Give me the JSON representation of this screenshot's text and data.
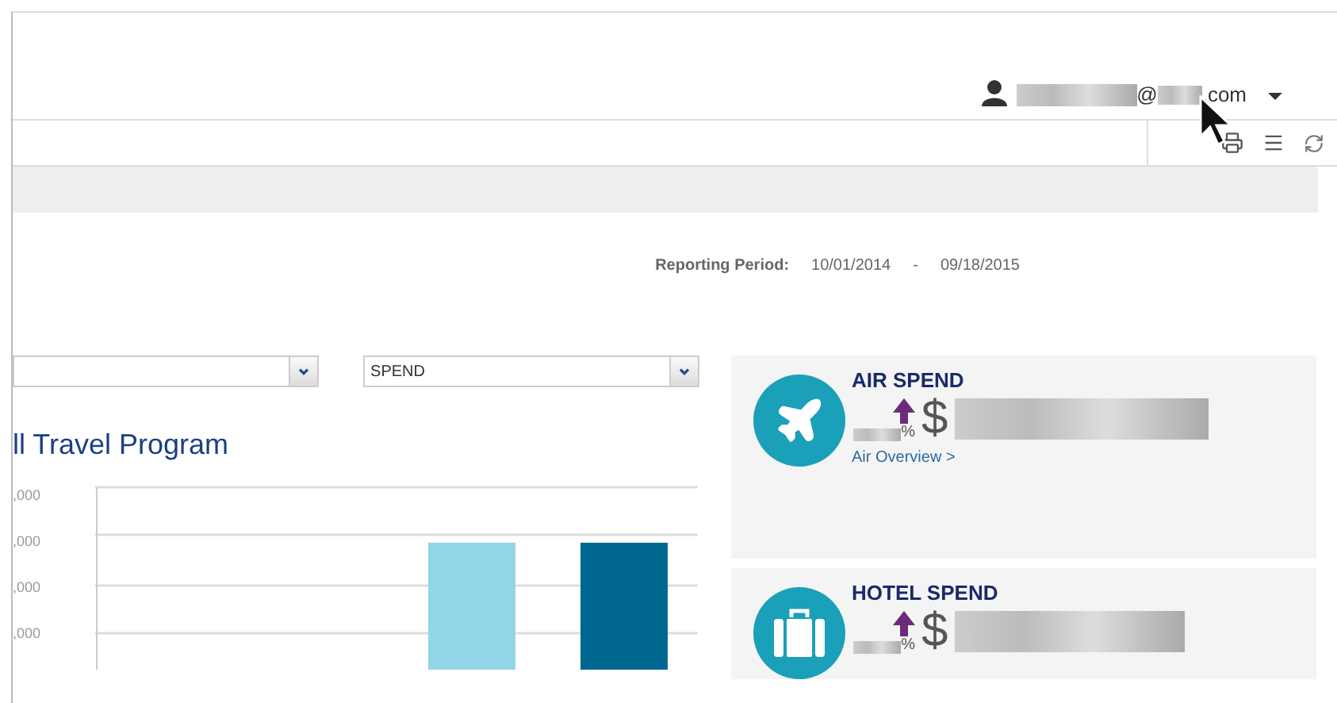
{
  "user_menu": {
    "email_at": "@",
    "email_domain": ".com"
  },
  "reporting_period": {
    "label": "Reporting Period:",
    "start": "10/01/2014",
    "separator": "-",
    "end": "09/18/2015"
  },
  "filters": [
    {
      "kind": "empty"
    },
    {
      "kind": "text",
      "value": "SPEND"
    }
  ],
  "chart": {
    "title": "ll Travel Program",
    "y_tick_labels": [
      ",000",
      ",000",
      ",000",
      ",000"
    ],
    "bars": [
      {
        "color": "#92d5e6"
      },
      {
        "color": "#006890"
      }
    ]
  },
  "cards": [
    {
      "kind": "air",
      "title": "AIR SPEND",
      "trend_up": true,
      "percent_sign": "%",
      "currency": "$",
      "link": "Air Overview >"
    },
    {
      "kind": "hotel",
      "title": "HOTEL SPEND",
      "trend_up": true,
      "percent_sign": "%",
      "currency": "$"
    }
  ]
}
